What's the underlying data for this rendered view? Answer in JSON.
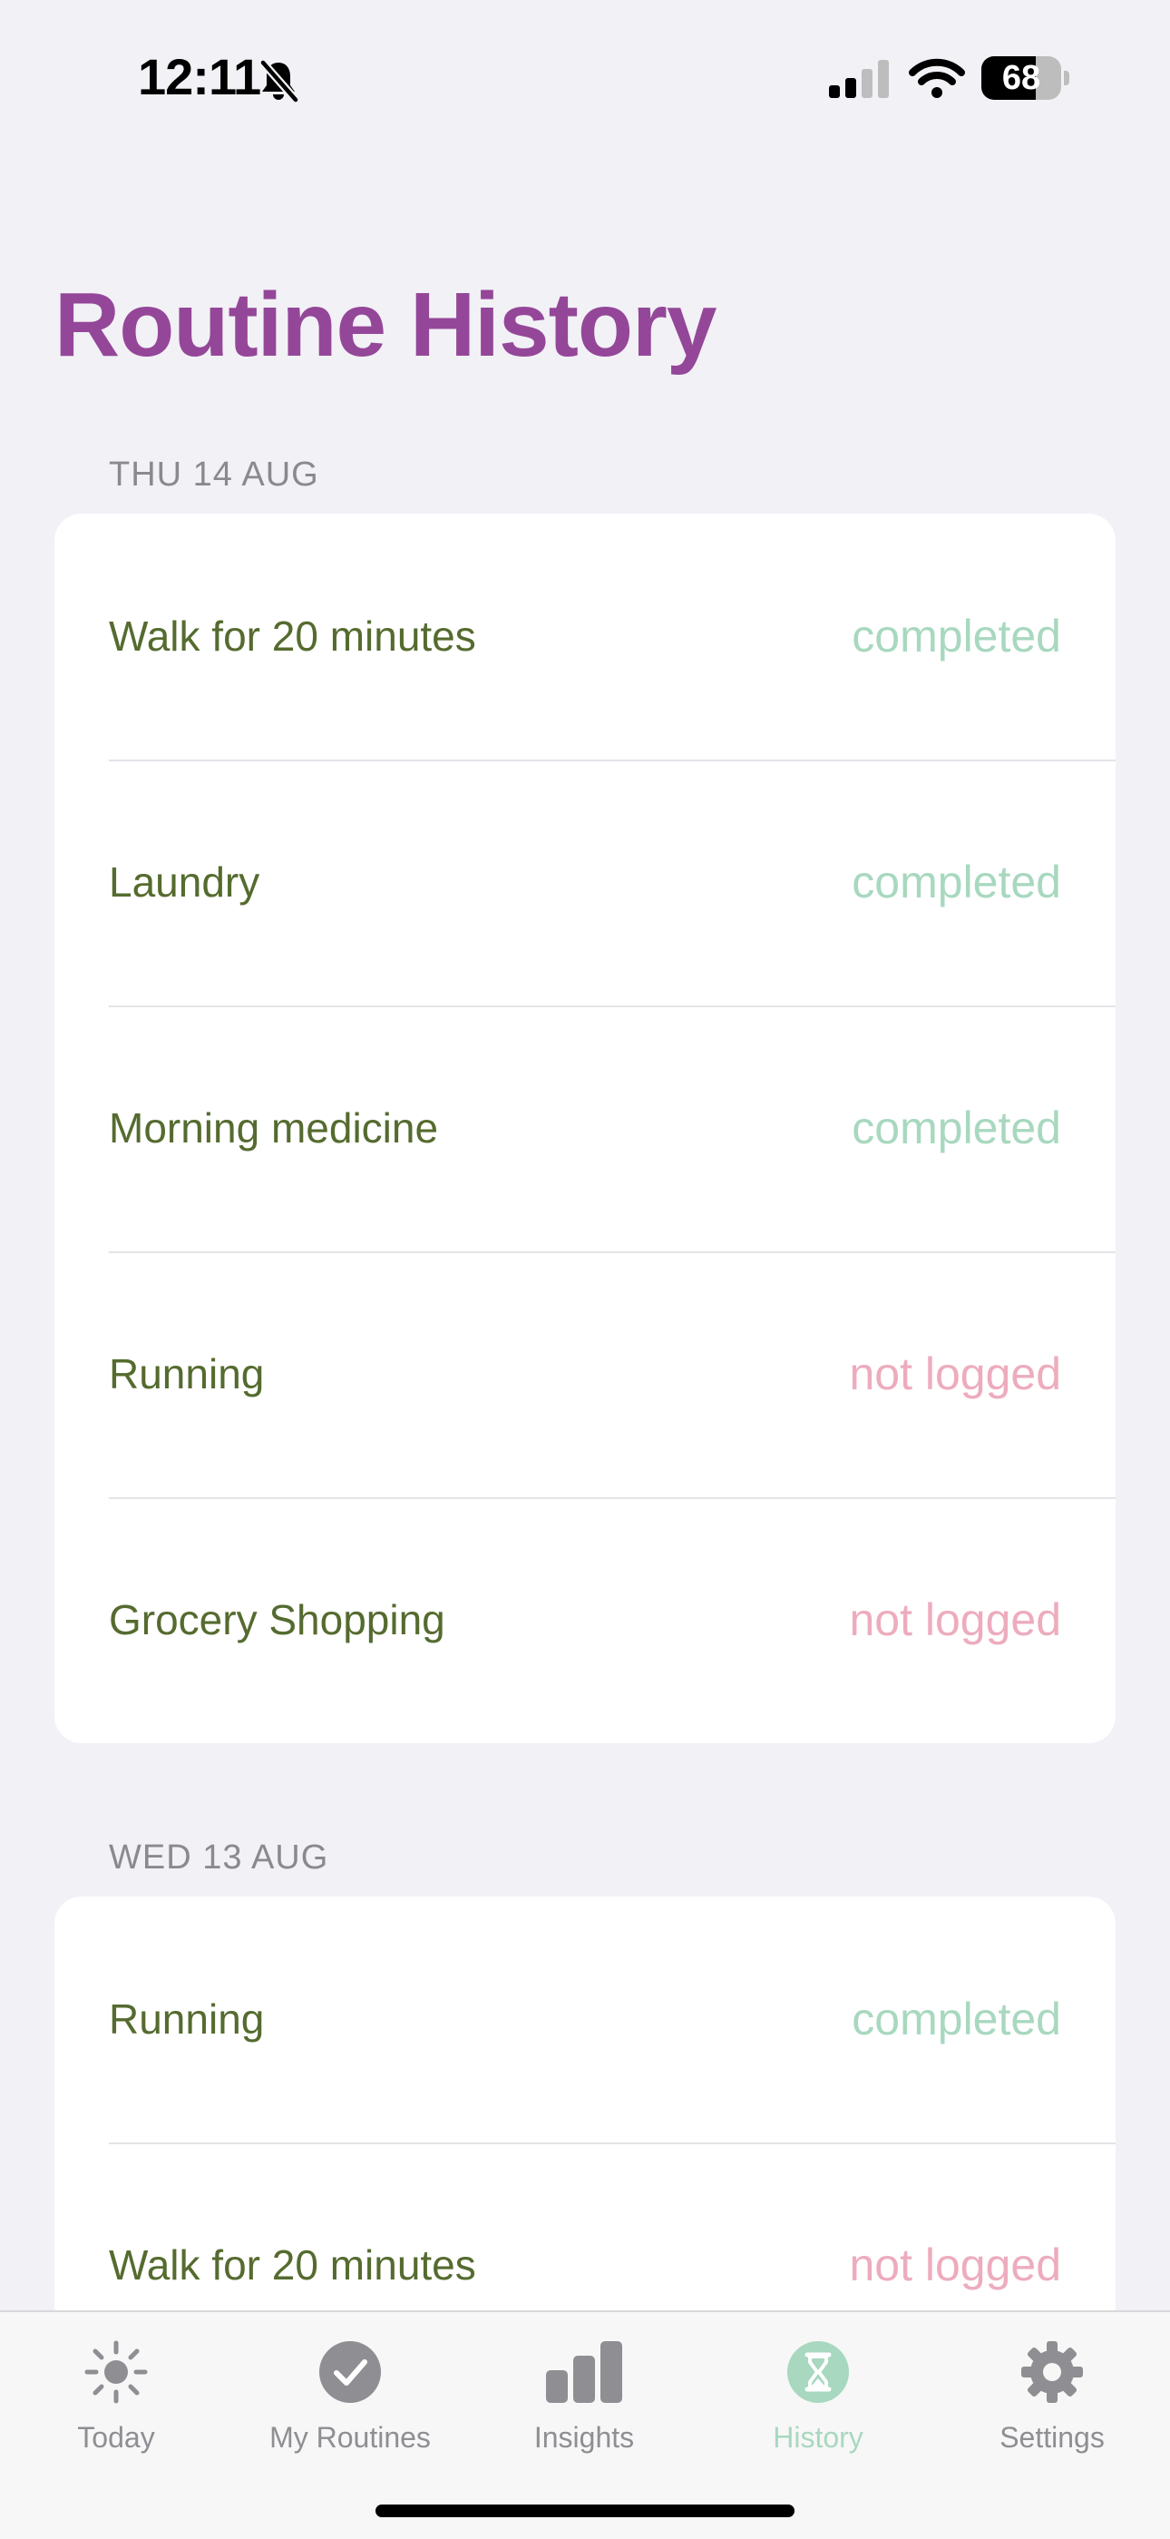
{
  "status_bar": {
    "time": "12:11",
    "battery": "68",
    "battery_level": 0.68
  },
  "page": {
    "title": "Routine History"
  },
  "sections": [
    {
      "date": "THU 14 AUG",
      "items": [
        {
          "title": "Walk for 20 minutes",
          "status": "completed"
        },
        {
          "title": "Laundry",
          "status": "completed"
        },
        {
          "title": "Morning medicine",
          "status": "completed"
        },
        {
          "title": "Running",
          "status": "not logged"
        },
        {
          "title": "Grocery Shopping",
          "status": "not logged"
        }
      ]
    },
    {
      "date": "WED 13 AUG",
      "items": [
        {
          "title": "Running",
          "status": "completed"
        },
        {
          "title": "Walk for 20 minutes",
          "status": "not logged"
        }
      ]
    }
  ],
  "status_colors": {
    "completed": "#A8D8BF",
    "not logged": "#EDACBD"
  },
  "colors": {
    "title": "#944799",
    "item_text": "#556B2F",
    "tab_active": "#A8D8BF",
    "tab_inactive": "#8E8E93"
  },
  "tab_bar": {
    "tabs": [
      {
        "label": "Today",
        "icon": "sun-icon",
        "active": false
      },
      {
        "label": "My Routines",
        "icon": "checkmark-circle-icon",
        "active": false
      },
      {
        "label": "Insights",
        "icon": "bar-chart-icon",
        "active": false
      },
      {
        "label": "History",
        "icon": "hourglass-icon",
        "active": true
      },
      {
        "label": "Settings",
        "icon": "gear-icon",
        "active": false
      }
    ]
  }
}
